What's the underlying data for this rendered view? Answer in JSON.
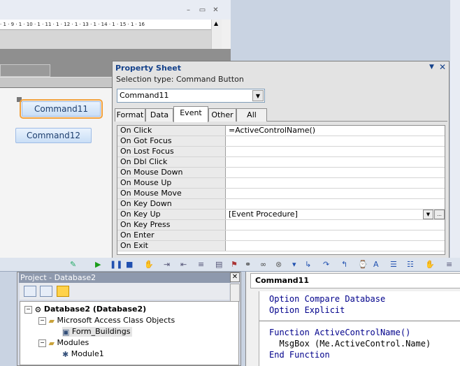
{
  "access": {
    "ruler_text": "· 1 · 9 · 1 · 10 · 1 · 11 · 1 · 12 · 1 · 13 · 1 · 14 · 1 · 15 · 1 · 16",
    "buttons": [
      {
        "label": "Command11"
      },
      {
        "label": "Command12"
      }
    ]
  },
  "property_sheet": {
    "title": "Property Sheet",
    "selection_type": "Selection type:  Command Button",
    "combo_value": "Command11",
    "tabs": [
      {
        "label": "Format"
      },
      {
        "label": "Data"
      },
      {
        "label": "Event"
      },
      {
        "label": "Other"
      },
      {
        "label": "All"
      }
    ],
    "active_tab": "Event",
    "rows": [
      {
        "name": "On Click",
        "value": "=ActiveControlName()"
      },
      {
        "name": "On Got Focus",
        "value": ""
      },
      {
        "name": "On Lost Focus",
        "value": ""
      },
      {
        "name": "On Dbl Click",
        "value": ""
      },
      {
        "name": "On Mouse Down",
        "value": ""
      },
      {
        "name": "On Mouse Up",
        "value": ""
      },
      {
        "name": "On Mouse Move",
        "value": ""
      },
      {
        "name": "On Key Down",
        "value": ""
      },
      {
        "name": "On Key Up",
        "value": "[Event Procedure]"
      },
      {
        "name": "On Key Press",
        "value": ""
      },
      {
        "name": "On Enter",
        "value": ""
      },
      {
        "name": "On Exit",
        "value": ""
      }
    ],
    "build_button_label": "..."
  },
  "project": {
    "title": "Project - Database2",
    "tree": {
      "root": "Database2 (Database2)",
      "folder1": "Microsoft Access Class Objects",
      "item1": "Form_Buildings",
      "folder2": "Modules",
      "item2": "Module1"
    }
  },
  "code": {
    "object_name": "Command11",
    "lines": [
      "Option Compare Database",
      "Option Explicit",
      "Function ActiveControlName()",
      "  MsgBox (Me.ActiveControl.Name)",
      "End Function"
    ]
  }
}
